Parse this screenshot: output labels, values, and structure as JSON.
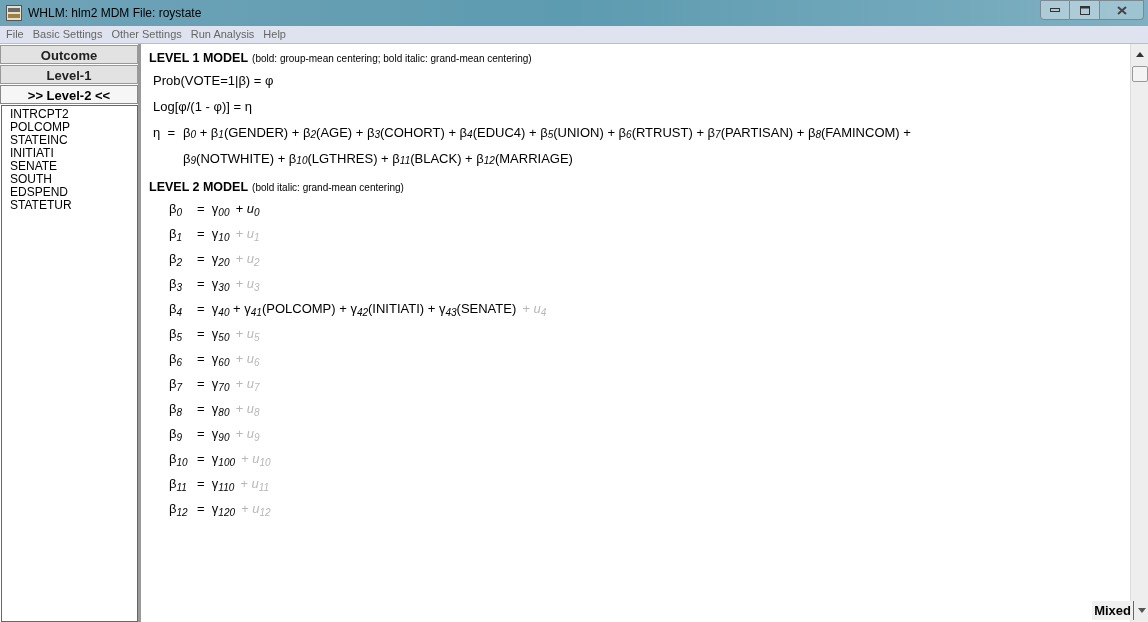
{
  "window": {
    "title": "WHLM: hlm2 MDM File: roystate"
  },
  "menu": [
    "File",
    "Basic Settings",
    "Other Settings",
    "Run Analysis",
    "Help"
  ],
  "nav_buttons": [
    {
      "label": "Outcome",
      "selected": false
    },
    {
      "label": "Level-1",
      "selected": false
    },
    {
      "label": ">> Level-2 <<",
      "selected": true
    }
  ],
  "variables": [
    "INTRCPT2",
    "POLCOMP",
    "STATEINC",
    "INITIATI",
    "SENATE",
    "SOUTH",
    "EDSPEND",
    "STATETUR"
  ],
  "level1": {
    "heading": "LEVEL 1 MODEL",
    "note": "(bold: group-mean centering; bold italic: grand-mean centering)",
    "lines": [
      "Prob(VOTE=1|β) = φ",
      "Log[φ/(1 - φ)] = η"
    ],
    "eta": {
      "symbol": "η  =",
      "lines": [
        "β$_{0}$ + β$_{1}$(GENDER) + β$_{2}$(AGE) + β$_{3}$(COHORT) + β$_{4}$(EDUC4) + β$_{5}$(UNION) + β$_{6}$(RTRUST) + β$_{7}$(PARTISAN) + β$_{8}$(FAMINCOM) +",
        "β$_{9}$(NOTWHITE) + β$_{10}$(LGTHRES) + β$_{11}$(BLACK) + β$_{12}$(MARRIAGE)"
      ]
    }
  },
  "level2": {
    "heading": "LEVEL 2 MODEL",
    "note": "(bold italic: grand-mean centering)",
    "equals": "=",
    "equations": [
      {
        "lhs": "β$_{0}$",
        "rhs": "γ$_{00}$",
        "error": "+ u$_{0}$",
        "random": true
      },
      {
        "lhs": "β$_{1}$",
        "rhs": "γ$_{10}$",
        "error": "+ u$_{1}$",
        "random": false
      },
      {
        "lhs": "β$_{2}$",
        "rhs": "γ$_{20}$",
        "error": "+ u$_{2}$",
        "random": false
      },
      {
        "lhs": "β$_{3}$",
        "rhs": "γ$_{30}$",
        "error": "+ u$_{3}$",
        "random": false
      },
      {
        "lhs": "β$_{4}$",
        "rhs": "γ$_{40}$ + γ$_{41}$(POLCOMP) + γ$_{42}$(INITIATI) + γ$_{43}$(SENATE)",
        "error": "+ u$_{4}$",
        "random": false
      },
      {
        "lhs": "β$_{5}$",
        "rhs": "γ$_{50}$",
        "error": "+ u$_{5}$",
        "random": false
      },
      {
        "lhs": "β$_{6}$",
        "rhs": "γ$_{60}$",
        "error": "+ u$_{6}$",
        "random": false
      },
      {
        "lhs": "β$_{7}$",
        "rhs": "γ$_{70}$",
        "error": "+ u$_{7}$",
        "random": false
      },
      {
        "lhs": "β$_{8}$",
        "rhs": "γ$_{80}$",
        "error": "+ u$_{8}$",
        "random": false
      },
      {
        "lhs": "β$_{9}$",
        "rhs": "γ$_{90}$",
        "error": "+ u$_{9}$",
        "random": false
      },
      {
        "lhs": "β$_{10}$",
        "rhs": "γ$_{100}$",
        "error": "+ u$_{10}$",
        "random": false
      },
      {
        "lhs": "β$_{11}$",
        "rhs": "γ$_{110}$",
        "error": "+ u$_{11}$",
        "random": false
      },
      {
        "lhs": "β$_{12}$",
        "rhs": "γ$_{120}$",
        "error": "+ u$_{12}$",
        "random": false
      }
    ]
  },
  "model_type": {
    "value": "Mixed"
  }
}
